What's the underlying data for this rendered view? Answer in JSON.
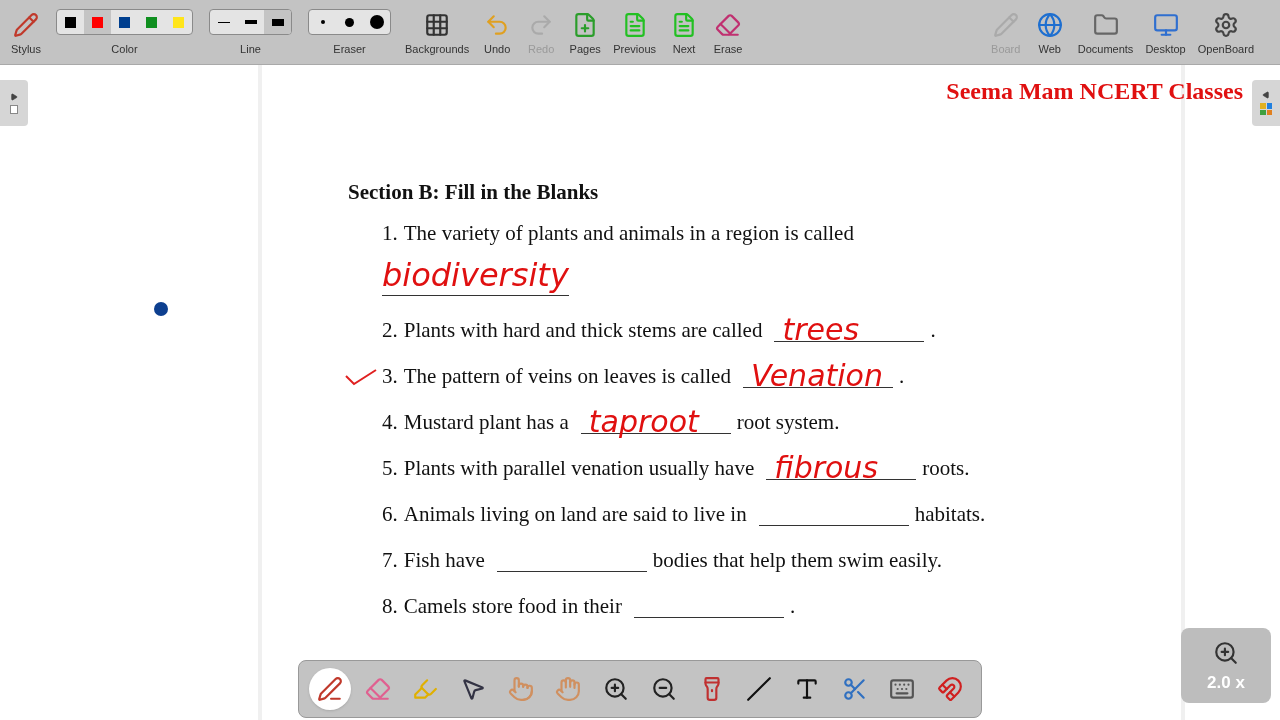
{
  "toolbar": {
    "left": [
      {
        "label": "Stylus",
        "disabled": false
      },
      {
        "label": "Color",
        "kind": "swatches",
        "swatches": [
          {
            "color": "#000000",
            "selected": false
          },
          {
            "color": "#ff0000",
            "selected": true
          },
          {
            "color": "#003f8f",
            "selected": false
          },
          {
            "color": "#0f8f1f",
            "selected": false
          },
          {
            "color": "#ffe51a",
            "selected": false
          }
        ]
      },
      {
        "label": "Line",
        "kind": "lines",
        "options": [
          {
            "selected": false
          },
          {
            "selected": false
          },
          {
            "selected": true
          }
        ]
      },
      {
        "label": "Eraser",
        "kind": "dots",
        "options": [
          {
            "selected": false
          },
          {
            "selected": false
          },
          {
            "selected": false
          }
        ]
      },
      {
        "label": "Backgrounds",
        "disabled": false
      },
      {
        "label": "Undo",
        "disabled": false
      },
      {
        "label": "Redo",
        "disabled": true
      },
      {
        "label": "Pages",
        "disabled": false
      },
      {
        "label": "Previous",
        "disabled": false
      },
      {
        "label": "Next",
        "disabled": false
      },
      {
        "label": "Erase",
        "disabled": false
      }
    ],
    "right": [
      {
        "label": "Board",
        "disabled": true
      },
      {
        "label": "Web",
        "disabled": false
      },
      {
        "label": "Documents",
        "disabled": false
      },
      {
        "label": "Desktop",
        "disabled": false
      },
      {
        "label": "OpenBoard",
        "disabled": false
      }
    ]
  },
  "channel_title": "Seema Mam NCERT Classes",
  "document": {
    "heading": "Section B: Fill in the Blanks",
    "questions": [
      {
        "number": "1.",
        "text": "The variety of plants and animals in a region is called",
        "answer": "biodiversity",
        "answer_below": true,
        "checked": false
      },
      {
        "number": "2.",
        "text": "Plants with hard and thick stems are called",
        "answer": "trees",
        "answer_below": false,
        "after": ".",
        "checked": false
      },
      {
        "number": "3.",
        "text": "The pattern of veins on leaves is called",
        "answer": "Venation",
        "answer_below": false,
        "after": ".",
        "checked": true
      },
      {
        "number": "4.",
        "text": "Mustard plant has a",
        "answer": "taproot",
        "answer_below": false,
        "after": "root system.",
        "checked": false
      },
      {
        "number": "5.",
        "text": "Plants with parallel venation usually have",
        "answer": "fibrous",
        "answer_below": false,
        "after": "roots.",
        "checked": false
      },
      {
        "number": "6.",
        "text": "Animals living on land are said to live in",
        "answer_below": false,
        "after": "habitats.",
        "checked": false
      },
      {
        "number": "7.",
        "text": "Fish have",
        "answer_below": false,
        "after": "bodies that help them swim easily.",
        "checked": false
      },
      {
        "number": "8.",
        "text": "Camels store food in their",
        "answer_below": false,
        "after": ".",
        "checked": false
      }
    ]
  },
  "floating_tools": [
    {
      "selected": true
    },
    {
      "selected": false
    },
    {
      "selected": false
    },
    {
      "selected": false
    },
    {
      "selected": false
    },
    {
      "selected": false
    },
    {
      "selected": false
    },
    {
      "selected": false
    },
    {
      "selected": false
    },
    {
      "selected": false
    },
    {
      "selected": false
    },
    {
      "selected": false
    },
    {
      "selected": false
    },
    {
      "selected": false
    }
  ],
  "zoom": {
    "label": "2.0 x"
  }
}
